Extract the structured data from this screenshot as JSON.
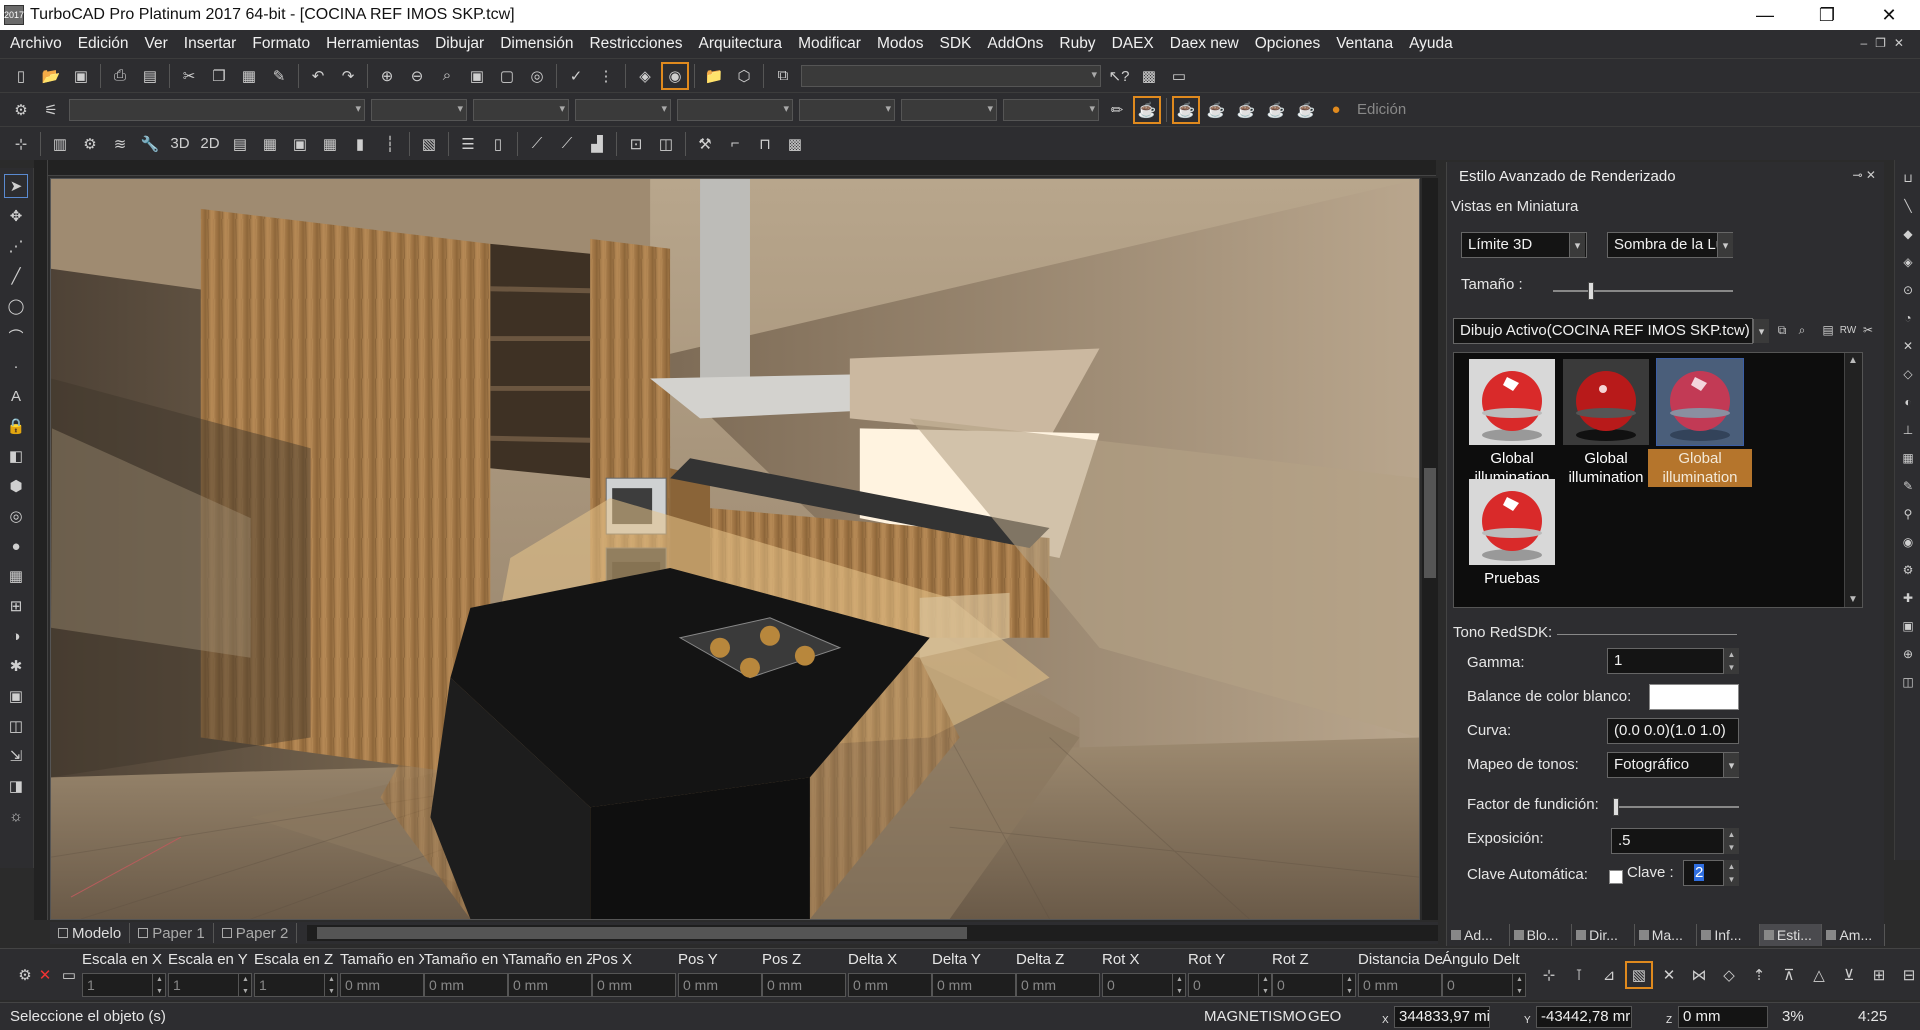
{
  "window": {
    "title": "TurboCAD Pro Platinum 2017 64-bit - [COCINA REF IMOS SKP.tcw]",
    "app_icon": "2017",
    "min": "—",
    "max": "❐",
    "close": "✕"
  },
  "menu": [
    "Archivo",
    "Edición",
    "Ver",
    "Insertar",
    "Formato",
    "Herramientas",
    "Dibujar",
    "Dimensión",
    "Restricciones",
    "Arquitectura",
    "Modificar",
    "Modos",
    "SDK",
    "AddOns",
    "Ruby",
    "DAEX",
    "Daex new",
    "Opciones",
    "Ventana",
    "Ayuda"
  ],
  "toolbar2": {
    "edicion_label": "Edición"
  },
  "toolbar3": {
    "label_3d": "3D",
    "label_2d": "2D"
  },
  "tabs": [
    {
      "label": "Modelo"
    },
    {
      "label": "Paper 1"
    },
    {
      "label": "Paper 2"
    }
  ],
  "panel": {
    "title": "Estilo Avanzado de Renderizado",
    "section_thumbs": "Vistas en Miniatura",
    "view_combo": "Límite 3D",
    "shadow_combo": "Sombra de la Lu",
    "size_label": "Tamaño :",
    "size_level": 0.2,
    "drawing_combo": "Dibujo Activo(COCINA REF IMOS SKP.tcw)",
    "materials": [
      {
        "label": "Global illumination",
        "selected": false
      },
      {
        "label": "Global illumination",
        "selected": false
      },
      {
        "label": "Global illumination",
        "selected": true
      },
      {
        "label": "Pruebas",
        "selected": false
      }
    ],
    "tone_section": "Tono RedSDK:",
    "gamma_label": "Gamma:",
    "gamma_value": "1",
    "white_balance_label": "Balance de color blanco:",
    "curve_label": "Curva:",
    "curve_value": "(0.0 0.0)(1.0 1.0)",
    "tone_mapping_label": "Mapeo de tonos:",
    "tone_mapping_value": "Fotográfico",
    "blend_factor_label": "Factor de fundición:",
    "blend_factor_level": 0.0,
    "exposure_label": "Exposición:",
    "exposure_value": ".5",
    "auto_key_label": "Clave Automática:",
    "key_label": "Clave :",
    "key_value": "2",
    "bottom_tabs": [
      "Ad...",
      "Blo...",
      "Dir...",
      "Ma...",
      "Inf...",
      "Esti...",
      "Am..."
    ]
  },
  "inspector": {
    "columns": [
      {
        "label": "Escala en X",
        "value": "1"
      },
      {
        "label": "Escala en Y",
        "value": "1"
      },
      {
        "label": "Escala en Z",
        "value": "1"
      },
      {
        "label": "Tamaño en X",
        "value": "0 mm"
      },
      {
        "label": "Tamaño en Y",
        "value": "0 mm"
      },
      {
        "label": "Tamaño en Z",
        "value": "0 mm"
      },
      {
        "label": "Pos X",
        "value": "0 mm"
      },
      {
        "label": "Pos Y",
        "value": "0 mm"
      },
      {
        "label": "Pos Z",
        "value": "0 mm"
      },
      {
        "label": "Delta X",
        "value": "0 mm"
      },
      {
        "label": "Delta Y",
        "value": "0 mm"
      },
      {
        "label": "Delta Z",
        "value": "0 mm"
      },
      {
        "label": "Rot X",
        "value": "0"
      },
      {
        "label": "Rot Y",
        "value": "0"
      },
      {
        "label": "Rot Z",
        "value": "0"
      },
      {
        "label": "Distancia De",
        "value": "0 mm"
      },
      {
        "label": "Ángulo Delt",
        "value": "0"
      }
    ]
  },
  "status": {
    "prompt": "Seleccione el objeto (s)",
    "snap": "MAGNETISMO",
    "geo": "GEO",
    "x_label": "X",
    "x_value": "344833,97 mi",
    "y_label": "Y",
    "y_value": "-43442,78 mr",
    "z_label": "Z",
    "z_value": "0 mm",
    "zoom": "3%",
    "time": "4:25"
  },
  "colors": {
    "chrome": "#2d2d30",
    "highlight": "#e08a1e",
    "selected_item": "#b5752c"
  },
  "icons": [
    "new-file-icon",
    "open-folder-icon",
    "save-icon",
    "print-icon",
    "print-preview-icon",
    "cut-icon",
    "copy-icon",
    "paste-icon",
    "undo-icon",
    "redo-icon",
    "zoom-icon",
    "render-icon",
    "select-arrow-icon",
    "gear-icon"
  ]
}
